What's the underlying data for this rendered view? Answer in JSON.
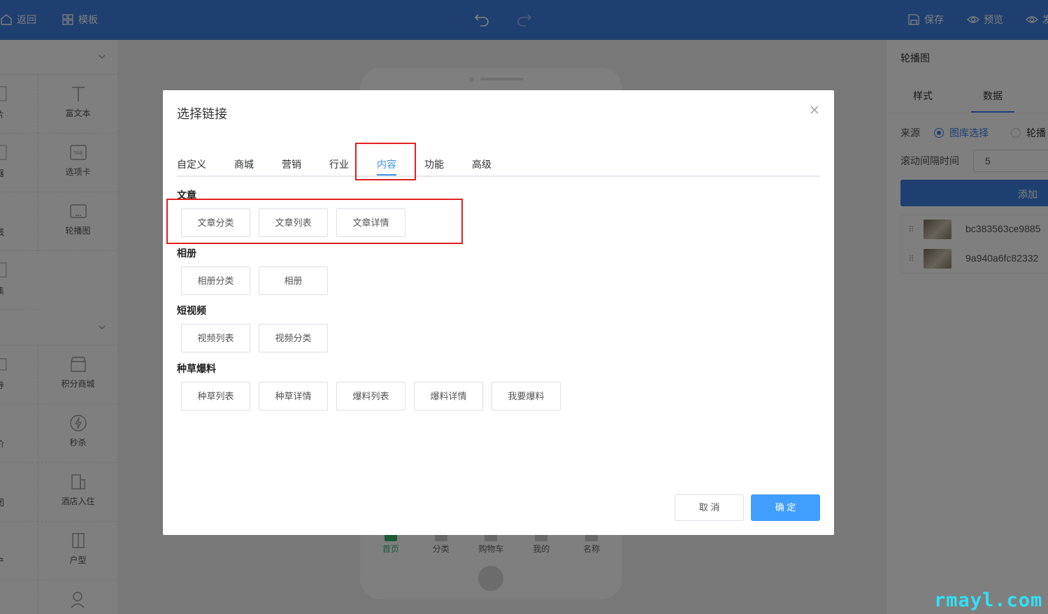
{
  "topbar": {
    "back_label": "返回",
    "template_label": "模板",
    "save_label": "保存",
    "preview_label": "预览",
    "publish_label": "发"
  },
  "left_panel": {
    "items": [
      {
        "label": "片",
        "icon": "image-icon"
      },
      {
        "label": "富文本",
        "icon": "text-icon"
      },
      {
        "label": "器",
        "icon": "box-icon"
      },
      {
        "label": "选项卡",
        "icon": "tab-icon"
      },
      {
        "label": "线",
        "icon": "line-icon"
      },
      {
        "label": "轮播图",
        "icon": "carousel-icon"
      },
      {
        "label": "集",
        "icon": "collection-icon"
      },
      {
        "label": "券",
        "icon": "coupon-icon"
      },
      {
        "label": "积分商城",
        "icon": "store-icon"
      },
      {
        "label": "价",
        "icon": "price-icon"
      },
      {
        "label": "秒杀",
        "icon": "lightning-icon"
      },
      {
        "label": "团",
        "icon": "group-icon"
      },
      {
        "label": "酒店入住",
        "icon": "hotel-icon"
      },
      {
        "label": "产",
        "icon": "property-icon"
      },
      {
        "label": "户型",
        "icon": "door-icon"
      }
    ]
  },
  "phone": {
    "tabbar": [
      "首页",
      "分类",
      "购物车",
      "我的",
      "名称"
    ]
  },
  "right_panel": {
    "title": "轮播图",
    "tabs": [
      "样式",
      "数据"
    ],
    "source_label": "来源",
    "source_options": [
      "图库选择",
      "轮播"
    ],
    "interval_label": "滚动间隔时间",
    "interval_value": "5",
    "add_label": "添加",
    "images": [
      "bc383563ce9885",
      "9a940a6fc82332"
    ]
  },
  "modal": {
    "title": "选择链接",
    "tabs": [
      "自定义",
      "商城",
      "营销",
      "行业",
      "内容",
      "功能",
      "高级"
    ],
    "active_tab": "内容",
    "groups": [
      {
        "title": "文章",
        "links": [
          "文章分类",
          "文章列表",
          "文章详情"
        ]
      },
      {
        "title": "相册",
        "links": [
          "相册分类",
          "相册"
        ]
      },
      {
        "title": "短视频",
        "links": [
          "视频列表",
          "视频分类"
        ]
      },
      {
        "title": "种草爆料",
        "links": [
          "种草列表",
          "种草详情",
          "爆料列表",
          "爆料详情",
          "我要爆料"
        ]
      }
    ],
    "cancel_label": "取 消",
    "confirm_label": "确 定"
  },
  "colors": {
    "topbar": "#3e7fe0",
    "accent": "#409eff",
    "annotation": "#e02020",
    "tab_active": "#3cb371"
  },
  "watermark": "rmayl.com"
}
